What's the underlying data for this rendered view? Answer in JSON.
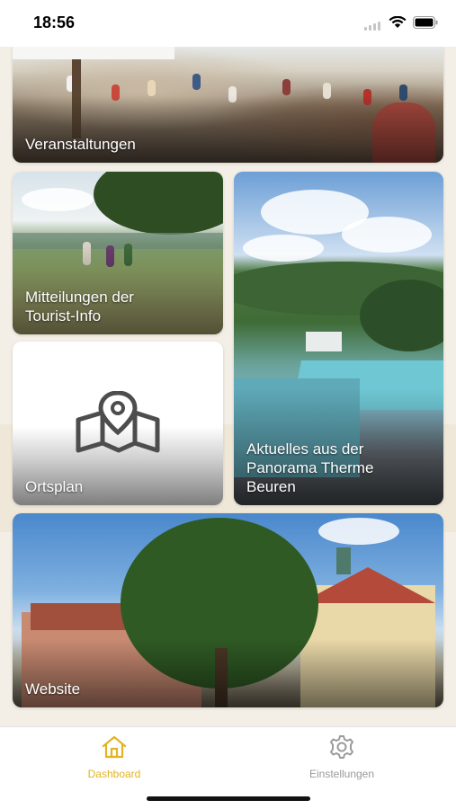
{
  "status_bar": {
    "time": "18:56"
  },
  "tiles": {
    "events": {
      "label": "Veranstaltungen",
      "image": "festival-crowd-photo"
    },
    "info": {
      "label": "Mitteilungen der\nTourist-Info",
      "image": "hikers-countryside-photo"
    },
    "therme": {
      "label": "Aktuelles aus der\nPanorama Therme\nBeuren",
      "image": "thermal-pool-photo"
    },
    "map": {
      "label": "Ortsplan",
      "icon": "map-pin-icon"
    },
    "web": {
      "label": "Website",
      "image": "town-hall-photo"
    }
  },
  "tab_bar": {
    "dashboard": {
      "label": "Dashboard",
      "icon": "home-icon",
      "active": true
    },
    "settings": {
      "label": "Einstellungen",
      "icon": "gear-icon",
      "active": false
    }
  },
  "colors": {
    "accent": "#e2b323",
    "inactive": "#9a9a9a",
    "background": "#f3efe6"
  }
}
